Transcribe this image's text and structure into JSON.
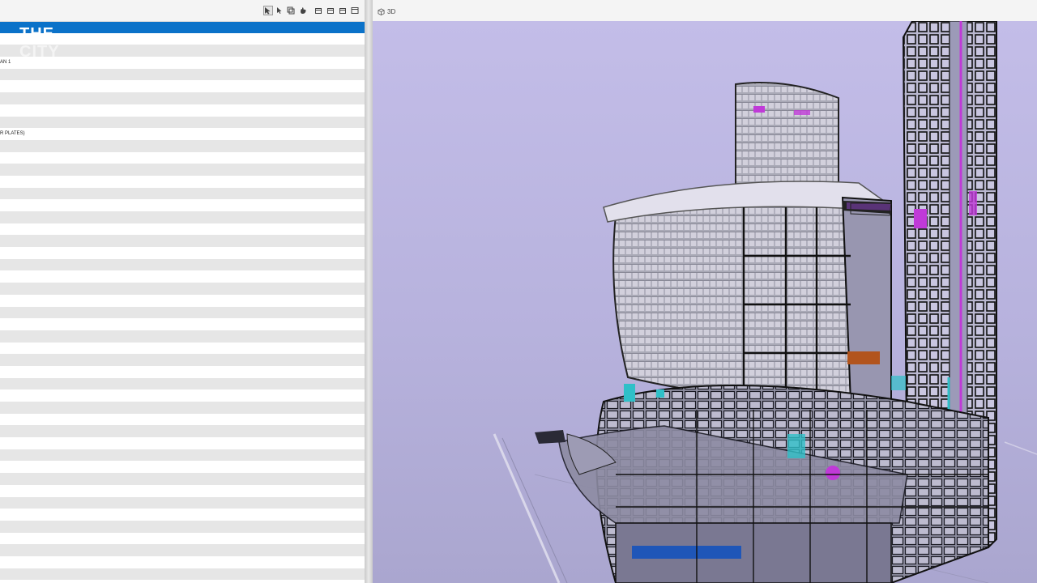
{
  "left_panel": {
    "watermark": {
      "line1": "THE",
      "line2": "CITY"
    },
    "rows": [
      "",
      "",
      "",
      "AN 1",
      "",
      "",
      "",
      "",
      "",
      "R PLATES)",
      "",
      "",
      "",
      "",
      "",
      "",
      "",
      "",
      "",
      "",
      "",
      "",
      "",
      "",
      "",
      "",
      "",
      "",
      "",
      "",
      "",
      "",
      "",
      "",
      "",
      "",
      "",
      "",
      "",
      "",
      "",
      "",
      "",
      "",
      "",
      "",
      ""
    ],
    "toolbar_icons": [
      "select-icon",
      "cursor-icon",
      "layers-icon",
      "hand-icon",
      "box-icon",
      "box-icon",
      "box-icon",
      "window-icon"
    ]
  },
  "view": {
    "tab_label": "3D",
    "tab_icon": "cube-icon"
  },
  "colors": {
    "selection": "#0b72c9",
    "viewport_bg": "#c3bde8",
    "accent_magenta": "#c03ad8",
    "accent_cyan": "#2fc0c8"
  }
}
